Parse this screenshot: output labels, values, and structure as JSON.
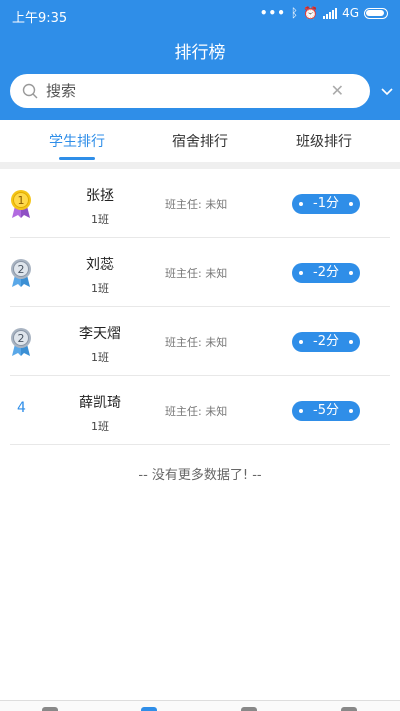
{
  "status_bar": {
    "time": "上午9:35",
    "network": "4G"
  },
  "header": {
    "title": "排行榜"
  },
  "search": {
    "placeholder": "搜索",
    "value": ""
  },
  "tabs": [
    {
      "label": "学生排行",
      "active": true
    },
    {
      "label": "宿舍排行",
      "active": false
    },
    {
      "label": "班级排行",
      "active": false
    }
  ],
  "ranking": [
    {
      "rank": "1",
      "name": "张拯",
      "class": "1班",
      "teacher": "班主任: 未知",
      "score": "-1分",
      "medal": "gold"
    },
    {
      "rank": "2",
      "name": "刘蕊",
      "class": "1班",
      "teacher": "班主任: 未知",
      "score": "-2分",
      "medal": "silver"
    },
    {
      "rank": "2",
      "name": "李天熠",
      "class": "1班",
      "teacher": "班主任: 未知",
      "score": "-2分",
      "medal": "silver"
    },
    {
      "rank": "4",
      "name": "薛凯琦",
      "class": "1班",
      "teacher": "班主任: 未知",
      "score": "-5分",
      "medal": "none"
    }
  ],
  "footer_text": "-- 没有更多数据了! --",
  "colors": {
    "primary": "#2f8ee8",
    "gold": "#f5c518",
    "silver": "#a9b4c2"
  }
}
